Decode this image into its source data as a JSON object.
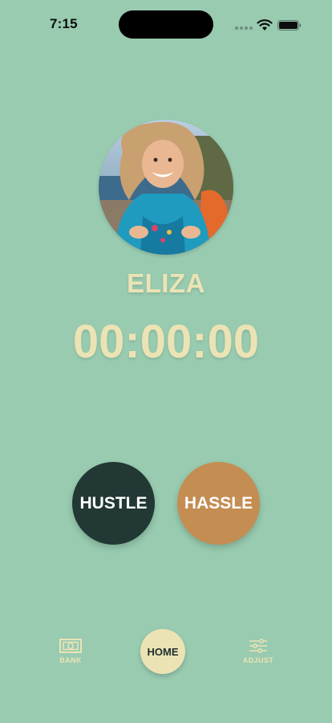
{
  "status_bar": {
    "time": "7:15"
  },
  "profile": {
    "name": "ELIZA",
    "timer": "00:00:00"
  },
  "actions": {
    "hustle_label": "HUSTLE",
    "hassle_label": "HASSLE"
  },
  "tab_bar": {
    "bank_label": "BANK",
    "home_label": "HOME",
    "adjust_label": "ADJUST"
  },
  "colors": {
    "background": "#98cbb0",
    "accent_text": "#ece3b5",
    "hustle": "#213835",
    "hassle": "#c48d52"
  },
  "icons": {
    "bank": "cash-icon",
    "adjust": "sliders-icon",
    "wifi": "wifi-icon",
    "battery": "battery-icon"
  }
}
